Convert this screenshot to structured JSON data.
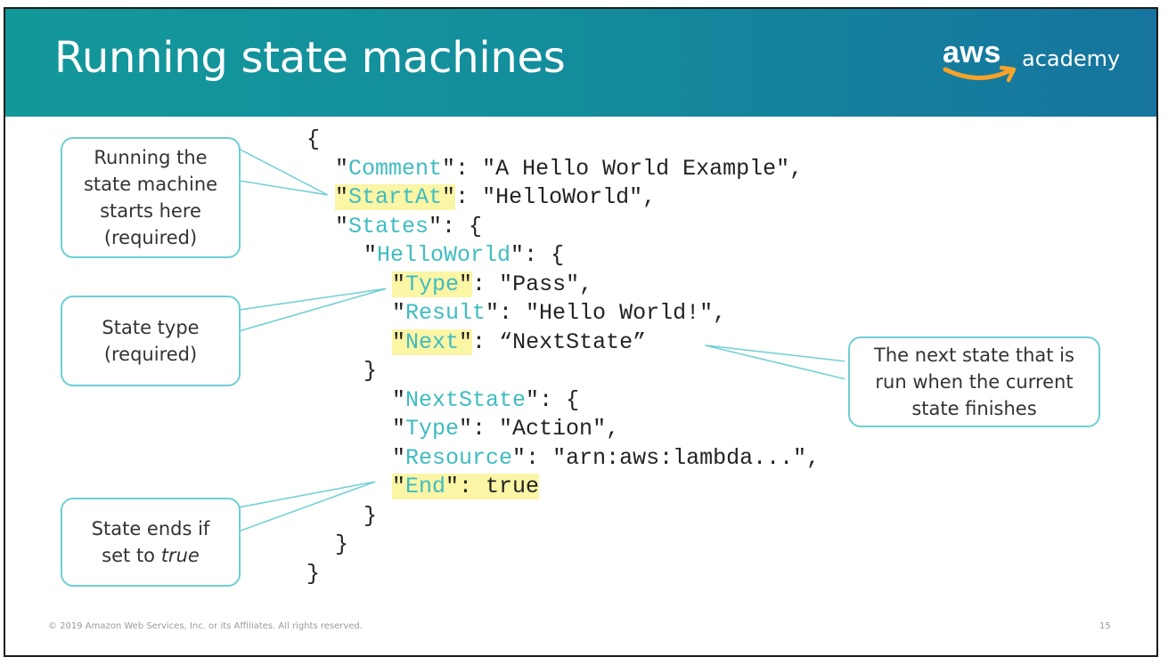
{
  "slide": {
    "title": "Running state machines",
    "logo": {
      "brand": "aws",
      "product": "academy"
    },
    "footer": "© 2019 Amazon Web Services, Inc. or its Affiliates. All rights reserved.",
    "page_number": "15"
  },
  "colors": {
    "header_start": "#13989a",
    "header_end": "#16749e",
    "json_key": "#3fbcc0",
    "highlight": "#fbf5a6",
    "callout_border": "#6dcfd2"
  },
  "code": {
    "open_brace": "{",
    "comment_key": "Comment",
    "comment_value": "\"A Hello World Example\",",
    "startat_key": "StartAt",
    "startat_value": "\"HelloWorld\",",
    "states_key": "States",
    "states_tail": ": {",
    "helloworld_key": "HelloWorld",
    "helloworld_tail": ": {",
    "type_key": "Type",
    "type_value": "\"Pass\",",
    "result_key": "Result",
    "result_value": "\"Hello World!\",",
    "next_key": "Next",
    "next_value": "“NextState”",
    "close_brace_1": "}",
    "nextstate_key": "NextState",
    "nextstate_tail": ": {",
    "type2_key": "Type",
    "type2_value": "\"Action\",",
    "resource_key": "Resource",
    "resource_value": "\"arn:aws:lambda...\",",
    "end_key": "End",
    "end_value": "true",
    "close_brace_2": "}",
    "close_brace_3": "}",
    "close_brace_4": "}"
  },
  "callouts": {
    "startat": "Running the\nstate machine\nstarts here\n(required)",
    "type": "State type\n(required)",
    "next": "The next state that is\nrun when the current\nstate finishes",
    "end_prefix": "State ends if\nset to ",
    "end_emphasis": "true"
  }
}
